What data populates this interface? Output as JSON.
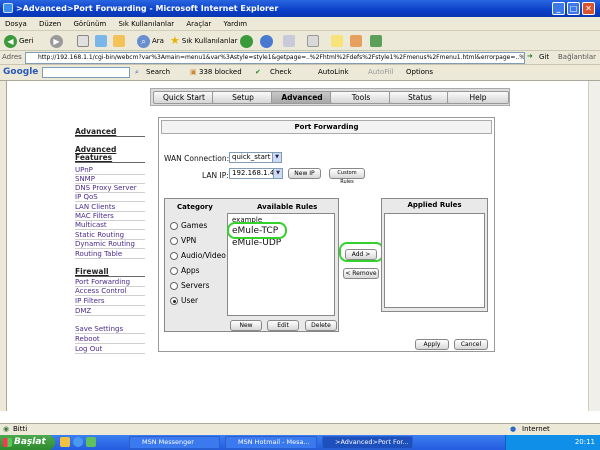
{
  "window": {
    "title": ">Advanced>Port Forwarding - Microsoft Internet Explorer",
    "minimize": "_",
    "maximize": "□",
    "close": "✕"
  },
  "menu": [
    "Dosya",
    "Düzen",
    "Görünüm",
    "Sık Kullanılanlar",
    "Araçlar",
    "Yardım"
  ],
  "toolbar": {
    "back": "Geri",
    "search": "Ara",
    "favorites": "Sık Kullanılanlar"
  },
  "address": {
    "label": "Adres",
    "url": "http://192.168.1.1/cgi-bin/webcm?var%3Amain=menu1&var%3Astyle=style1&getpage=..%2Fhtml%2Fdefs%2Fstyle1%2Fmenus%2Fmenu1.html&errorpage=..%2Fh",
    "go": "Git",
    "links": "Bağlantılar"
  },
  "google": {
    "brand": "Google",
    "search": "Search",
    "blocked": "338 blocked",
    "check": "Check",
    "autolink": "AutoLink",
    "autofill": "AutoFill",
    "options": "Options"
  },
  "tabs": [
    "Quick Start",
    "Setup",
    "Advanced",
    "Tools",
    "Status",
    "Help"
  ],
  "nav": {
    "head1": "Advanced",
    "head2": "Advanced Features",
    "features": [
      "UPnP",
      "SNMP",
      "DNS Proxy Server",
      "IP QoS",
      "LAN Clients",
      "MAC Filters",
      "Multicast",
      "Static Routing",
      "Dynamic Routing",
      "Routing Table"
    ],
    "head3": "Firewall",
    "firewall": [
      "Port Forwarding",
      "Access Control",
      "IP Filters",
      "DMZ"
    ],
    "bottom": [
      "Save Settings",
      "Reboot",
      "Log Out"
    ]
  },
  "panel": {
    "title": "Port Forwarding",
    "wan_label": "WAN Connection:",
    "wan_value": "quick_start",
    "lan_label": "LAN IP:",
    "lan_value": "192.168.1.4",
    "new_ip": "New IP",
    "custom_rules": "Custom Rules",
    "category_head": "Category",
    "available_head": "Available Rules",
    "applied_head": "Applied Rules",
    "categories": [
      "Games",
      "VPN",
      "Audio/Video",
      "Apps",
      "Servers",
      "User"
    ],
    "selected_category": "User",
    "available": {
      "header": "example",
      "items": [
        "eMule-TCP",
        "eMule-UDP"
      ]
    },
    "add": "Add >",
    "remove": "< Remove",
    "new": "New",
    "edit": "Edit",
    "delete": "Delete",
    "apply": "Apply",
    "cancel": "Cancel"
  },
  "status": {
    "left": "Bitti",
    "zone": "Internet"
  },
  "taskbar": {
    "start": "Başlat",
    "tasks": [
      "MSN Messenger",
      "MSN Hotmail - Mesa...",
      ">Advanced>Port For..."
    ],
    "time": "20:11"
  },
  "colors": {
    "highlight_ring": "#34d12c",
    "nav_link": "#4a2b8a",
    "xp_blue": "#245ce0"
  }
}
